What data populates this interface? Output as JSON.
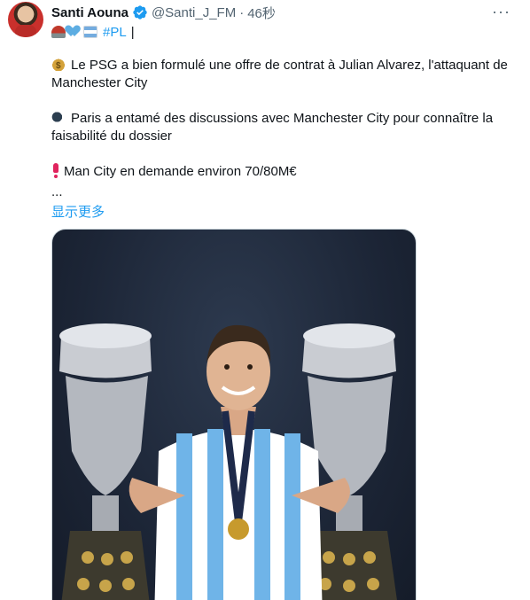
{
  "author": {
    "display_name": "Santi Aouna",
    "handle": "@Santi_J_FM",
    "separator": "·",
    "timestamp": "46秒"
  },
  "bio_line": {
    "hashtag": "#PL",
    "separator": "|"
  },
  "tweet": {
    "para1": "Le PSG a bien formulé une offre de contrat à Julian Alvarez, l'attaquant de Manchester City",
    "para2": "Paris a entamé des discussions avec Manchester City pour connaître la faisabilité du dossier",
    "para3": "Man City en demande environ 70/80M€",
    "ellipsis": "...",
    "show_more": "显示更多"
  },
  "media": {
    "kind": "photo"
  },
  "colors": {
    "link": "#1d9bf0",
    "muted": "#536471",
    "text": "#0f1419"
  },
  "icons": [
    "verified-badge-icon",
    "more-options-icon",
    "siren-emoji",
    "blue-heart-emoji",
    "argentina-flag-emoji",
    "money-bag-emoji",
    "speaking-head-emoji",
    "exclamation-emoji"
  ]
}
